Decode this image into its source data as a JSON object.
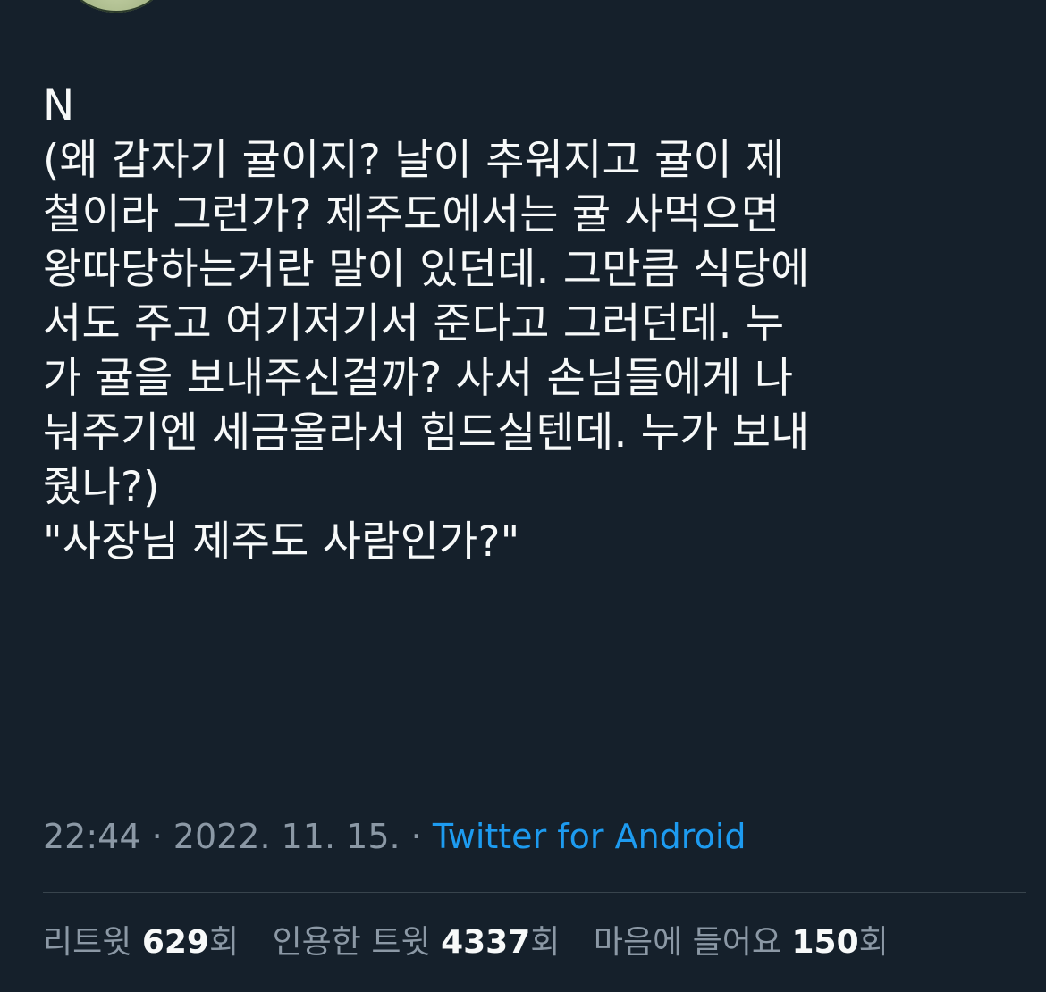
{
  "tweet": {
    "lines": [
      "N",
      "(왜 갑자기 귤이지? 날이 추워지고 귤이 제",
      "철이라 그런가? 제주도에서는 귤 사먹으면",
      "왕따당하는거란 말이 있던데. 그만큼 식당에",
      "서도 주고 여기저기서 준다고 그러던데. 누",
      "가 귤을 보내주신걸까? 사서 손님들에게 나",
      "눠주기엔 세금올라서 힘드실텐데. 누가 보내",
      "줬나?)",
      "\"사장님 제주도 사람인가?\""
    ]
  },
  "meta": {
    "time": "22:44",
    "separator": " · ",
    "date": "2022. 11. 15.",
    "source": "Twitter for Android"
  },
  "stats": {
    "retweets": {
      "label": "리트윗",
      "count": "629",
      "suffix": "회"
    },
    "quotes": {
      "label": "인용한 트윗",
      "count": "4337",
      "suffix": "회"
    },
    "likes": {
      "label": "마음에 들어요",
      "count": "150",
      "suffix": "회"
    }
  },
  "colors": {
    "background": "#15202b",
    "text": "#f7f9f9",
    "secondary": "#8b98a5",
    "link": "#1d9bf0",
    "divider": "#38444d"
  },
  "icons": {
    "avatar": "profile-avatar"
  }
}
